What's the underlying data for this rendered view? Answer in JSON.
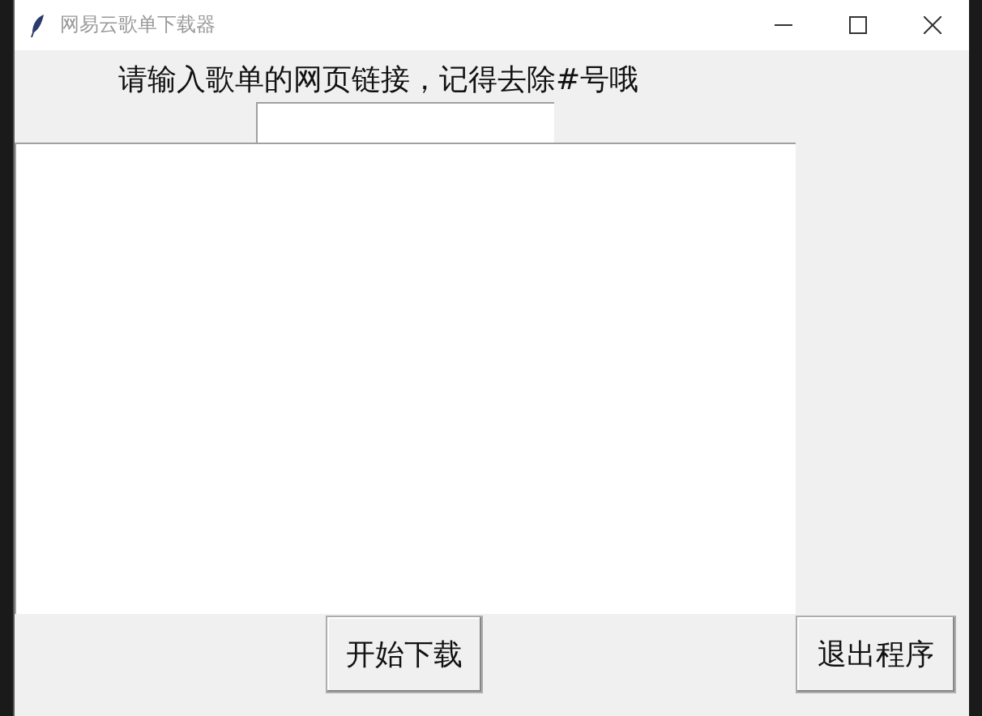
{
  "window": {
    "title": "网易云歌单下载器"
  },
  "prompt_label": "请输入歌单的网页链接，记得去除#号哦",
  "buttons": [
    {
      "label": "开始下载"
    },
    {
      "label": "退出程序"
    }
  ]
}
